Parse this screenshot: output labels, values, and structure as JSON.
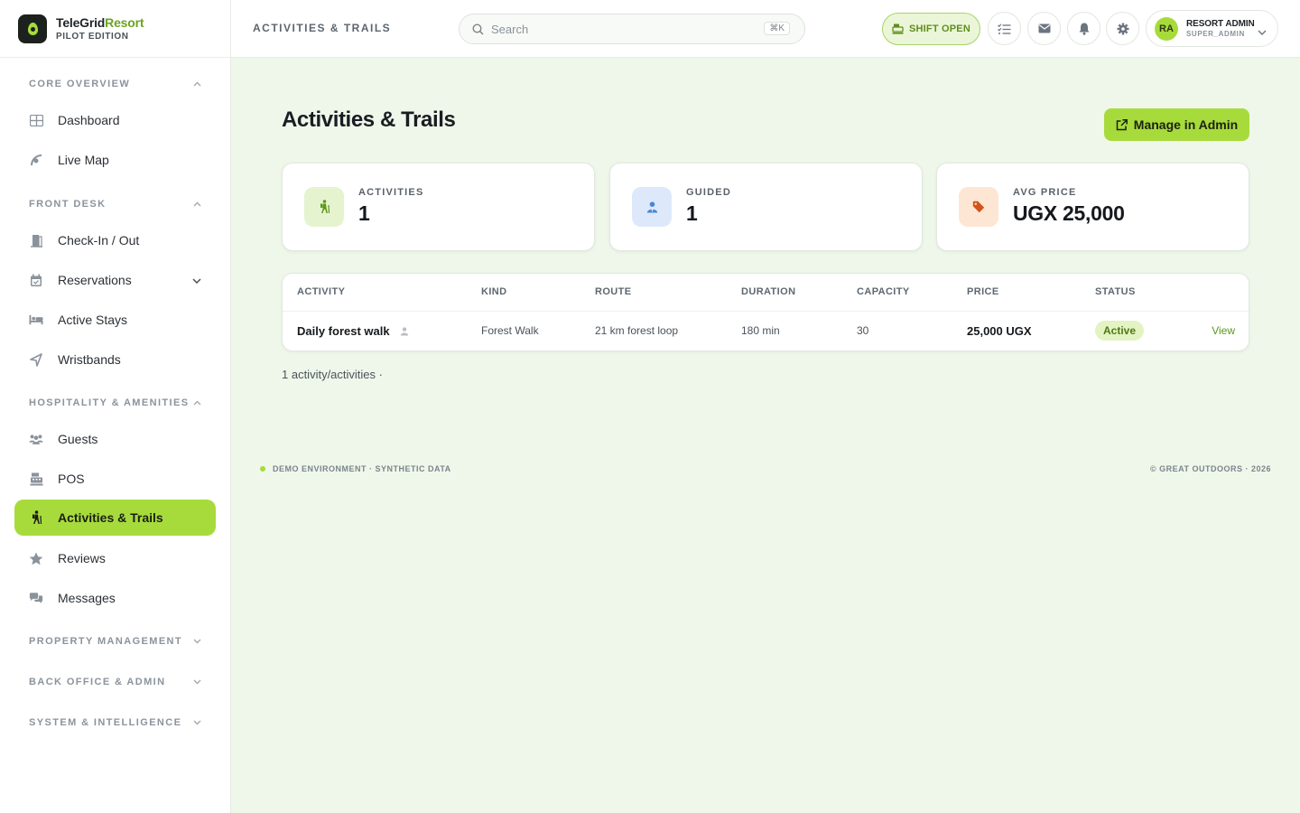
{
  "brand": {
    "name_main": "TeleGrid",
    "name_accent": "Resort",
    "edition": "PILOT EDITION"
  },
  "sidebar": {
    "sections": [
      {
        "label": "CORE OVERVIEW",
        "expanded": true
      },
      {
        "label": "FRONT DESK",
        "expanded": true
      },
      {
        "label": "HOSPITALITY & AMENITIES",
        "expanded": true
      },
      {
        "label": "PROPERTY MANAGEMENT",
        "expanded": false
      },
      {
        "label": "BACK OFFICE & ADMIN",
        "expanded": false
      },
      {
        "label": "SYSTEM & INTELLIGENCE",
        "expanded": false
      }
    ],
    "items": [
      {
        "label": "Dashboard",
        "icon": "grid-icon"
      },
      {
        "label": "Live Map",
        "icon": "map-icon"
      },
      {
        "label": "Check-In / Out",
        "icon": "door-icon"
      },
      {
        "label": "Reservations",
        "icon": "calendar-icon"
      },
      {
        "label": "Active Stays",
        "icon": "bed-icon"
      },
      {
        "label": "Wristbands",
        "icon": "wristband-icon"
      },
      {
        "label": "Guests",
        "icon": "users-icon"
      },
      {
        "label": "POS",
        "icon": "register-icon"
      },
      {
        "label": "Activities & Trails",
        "icon": "hiker-icon",
        "active": true
      },
      {
        "label": "Reviews",
        "icon": "star-icon"
      },
      {
        "label": "Messages",
        "icon": "chat-icon"
      }
    ]
  },
  "topbar": {
    "title": "ACTIVITIES & TRAILS",
    "search_placeholder": "Search",
    "search_shortcut": "⌘K",
    "shift_label": "SHIFT OPEN",
    "user": {
      "initials": "RA",
      "name": "RESORT ADMIN",
      "role": "SUPER_ADMIN"
    }
  },
  "main": {
    "title": "Activities & Trails",
    "manage_button": "Manage in Admin",
    "stats": [
      {
        "label": "ACTIVITIES",
        "value": "1"
      },
      {
        "label": "GUIDED",
        "value": "1"
      },
      {
        "label": "AVG PRICE",
        "value": "UGX 25,000"
      }
    ],
    "table": {
      "columns": [
        "ACTIVITY",
        "KIND",
        "ROUTE",
        "DURATION",
        "CAPACITY",
        "PRICE",
        "STATUS"
      ],
      "rows": [
        {
          "activity": "Daily forest walk",
          "kind": "Forest Walk",
          "route": "21 km forest loop",
          "duration": "180 min",
          "capacity": "30",
          "price": "25,000 UGX",
          "status": "Active",
          "action": "View"
        }
      ]
    },
    "count_text": "1 activity/activities ·"
  },
  "footer": {
    "left": "DEMO ENVIRONMENT · SYNTHETIC DATA",
    "right": "© GREAT OUTDOORS · 2026"
  },
  "colors": {
    "accent": "#a7db3c",
    "page_bg": "#eef7ea",
    "status_active_bg": "#e3f3c3"
  }
}
